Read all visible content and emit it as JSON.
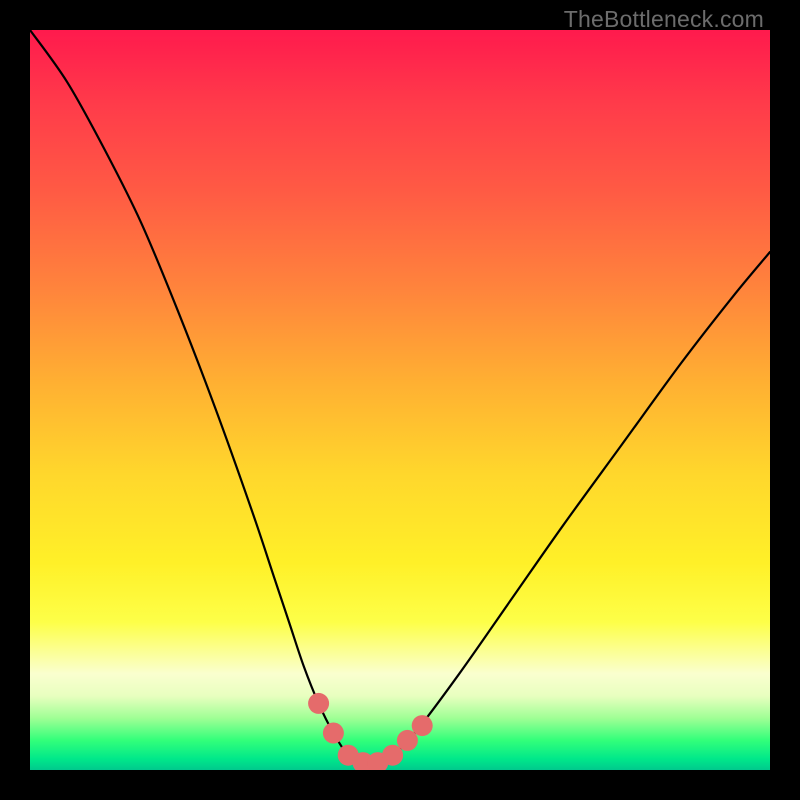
{
  "watermark": "TheBottleneck.com",
  "colors": {
    "frame": "#000000",
    "curve_stroke": "#000000",
    "marker_fill": "#e56b6b",
    "marker_stroke": "#000000"
  },
  "chart_data": {
    "type": "line",
    "title": "",
    "xlabel": "",
    "ylabel": "",
    "xlim": [
      0,
      100
    ],
    "ylim": [
      0,
      100
    ],
    "grid": false,
    "series": [
      {
        "name": "bottleneck-curve",
        "x": [
          0,
          5,
          10,
          15,
          20,
          25,
          30,
          33,
          35,
          37,
          39,
          41,
          43,
          45,
          47,
          49,
          52,
          58,
          65,
          72,
          80,
          88,
          95,
          100
        ],
        "values": [
          100,
          93,
          84,
          74,
          62,
          49,
          35,
          26,
          20,
          14,
          9,
          5,
          2,
          1,
          1,
          2,
          5,
          13,
          23,
          33,
          44,
          55,
          64,
          70
        ]
      }
    ],
    "markers": {
      "name": "fit-region",
      "x": [
        39,
        41,
        43,
        45,
        47,
        49,
        51,
        53
      ],
      "values": [
        9,
        5,
        2,
        1,
        1,
        2,
        4,
        6
      ]
    },
    "background_gradient_meaning": "vertical axis encodes bottleneck severity: top (red) = high bottleneck, bottom (green) = optimal"
  }
}
